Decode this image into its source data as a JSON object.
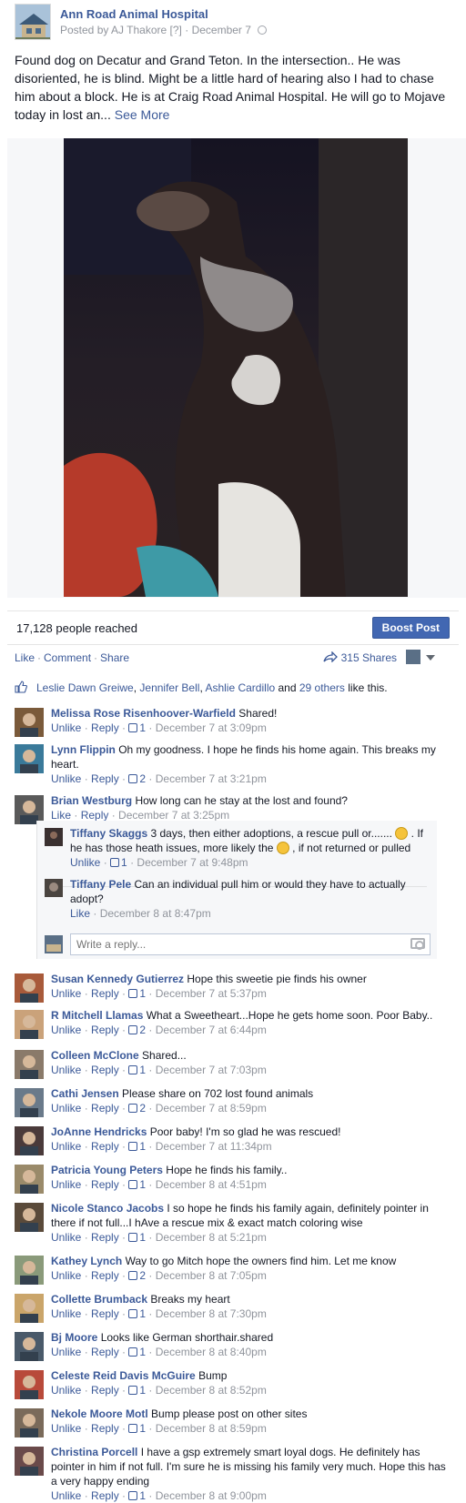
{
  "post": {
    "page_name": "Ann Road Animal Hospital",
    "posted_by": "Posted by AJ Thakore",
    "posted_by_marker": "[?]",
    "date": "December 7",
    "text": "Found dog on Decatur and Grand Teton. In the intersection.. He was disoriented, he is blind. Might be a little hard of hearing also I had to chase him about a block. He is at Craig Road Animal Hospital. He will go to Mojave today in lost an...",
    "see_more": "See More",
    "people_reached": "17,128 people reached",
    "boost_label": "Boost Post",
    "actions": [
      "Like",
      "Comment",
      "Share"
    ],
    "shares_label": "315 Shares",
    "likes_names": [
      "Leslie Dawn Greiwe",
      "Jennifer Bell",
      "Ashlie Cardillo"
    ],
    "likes_others": "29 others",
    "likes_suffix": "like this."
  },
  "comments": [
    {
      "author": "Melissa Rose Risenhoover-Warfield",
      "text": "Shared!",
      "action": "Unlike",
      "reply": "Reply",
      "likes": "1",
      "time": "December 7 at 3:09pm"
    },
    {
      "author": "Lynn Flippin",
      "text": "Oh my goodness. I hope he finds his home again. This breaks my heart.",
      "action": "Unlike",
      "reply": "Reply",
      "likes": "2",
      "time": "December 7 at 3:21pm"
    },
    {
      "author": "Brian Westburg",
      "text": "How long can he stay at the lost and found?",
      "action": "Like",
      "reply": "Reply",
      "likes": "",
      "time": "December 7 at 3:25pm"
    },
    {
      "author": "Susan Kennedy Gutierrez",
      "text": "Hope this sweetie pie finds his owner",
      "action": "Unlike",
      "reply": "Reply",
      "likes": "1",
      "time": "December 7 at 5:37pm"
    },
    {
      "author": "R Mitchell Llamas",
      "text": "What a Sweetheart...Hope he gets home soon. Poor Baby..",
      "action": "Unlike",
      "reply": "Reply",
      "likes": "2",
      "time": "December 7 at 6:44pm"
    },
    {
      "author": "Colleen McClone",
      "text": "Shared...",
      "action": "Unlike",
      "reply": "Reply",
      "likes": "1",
      "time": "December 7 at 7:03pm"
    },
    {
      "author": "Cathi Jensen",
      "text": "Please share on 702 lost found animals",
      "action": "Unlike",
      "reply": "Reply",
      "likes": "2",
      "time": "December 7 at 8:59pm"
    },
    {
      "author": "JoAnne Hendricks",
      "text": "Poor baby! I'm so glad he was rescued!",
      "action": "Unlike",
      "reply": "Reply",
      "likes": "1",
      "time": "December 7 at 11:34pm"
    },
    {
      "author": "Patricia Young Peters",
      "text": "Hope he finds his family..",
      "action": "Unlike",
      "reply": "Reply",
      "likes": "1",
      "time": "December 8 at 4:51pm"
    },
    {
      "author": "Nicole Stanco Jacobs",
      "text": "I so hope he finds his family again, definitely pointer in there if not full...I hAve a rescue mix & exact match coloring wise",
      "action": "Unlike",
      "reply": "Reply",
      "likes": "1",
      "time": "December 8 at 5:21pm"
    },
    {
      "author": "Kathey Lynch",
      "text": "Way to go Mitch hope the owners find him. Let me know",
      "action": "Unlike",
      "reply": "Reply",
      "likes": "2",
      "time": "December 8 at 7:05pm"
    },
    {
      "author": "Collette Brumback",
      "text": "Breaks my heart",
      "action": "Unlike",
      "reply": "Reply",
      "likes": "1",
      "time": "December 8 at 7:30pm"
    },
    {
      "author": "Bj Moore",
      "text": "Looks like German shorthair.shared",
      "action": "Unlike",
      "reply": "Reply",
      "likes": "1",
      "time": "December 8 at 8:40pm"
    },
    {
      "author": "Celeste Reid Davis McGuire",
      "text": "Bump",
      "action": "Unlike",
      "reply": "Reply",
      "likes": "1",
      "time": "December 8 at 8:52pm"
    },
    {
      "author": "Nekole Moore Motl",
      "text": "Bump please post on other sites",
      "action": "Unlike",
      "reply": "Reply",
      "likes": "1",
      "time": "December 8 at 8:59pm"
    },
    {
      "author": "Christina Porcell",
      "text": "I have a gsp extremely smart loyal dogs. He definitely has pointer in him if not full. I'm sure he is missing his family very much. Hope this has a very happy ending",
      "action": "Unlike",
      "reply": "Reply",
      "likes": "1",
      "time": "December 8 at 9:00pm"
    }
  ],
  "replies": [
    {
      "author": "Tiffany Skaggs",
      "text_a": "3 days, then either adoptions, a rescue pull or.......",
      "text_b": ". If he has those heath issues, more likely the",
      "text_c": ", if not returned or pulled",
      "action": "Unlike",
      "likes": "1",
      "time": "December 7 at 9:48pm"
    },
    {
      "author": "Tiffany Pele",
      "text": "Can an individual pull him or would they have to actually adopt?",
      "action": "Like",
      "time": "December 8 at 8:47pm"
    }
  ],
  "reply_placeholder": "Write a reply...",
  "colors": {
    "link": "#3b5998",
    "boost": "#4267b2",
    "muted": "#90949c"
  }
}
